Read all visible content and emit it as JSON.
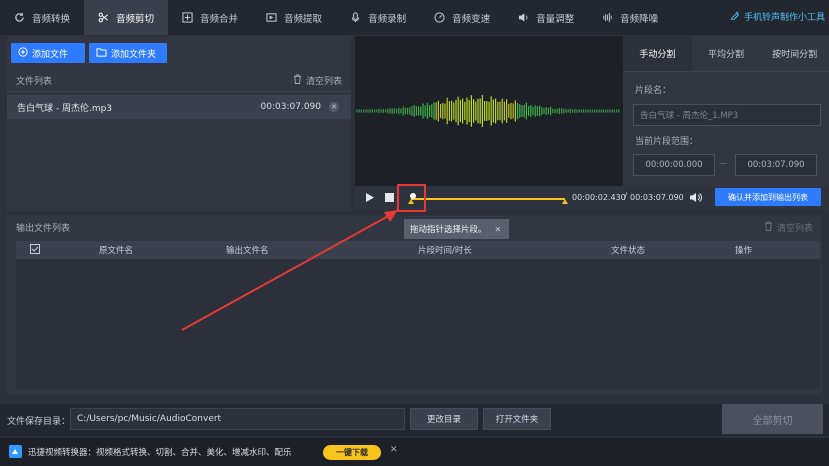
{
  "nav": {
    "tabs": [
      {
        "label": "音频转换",
        "icon": "refresh-icon"
      },
      {
        "label": "音频剪切",
        "icon": "scissors-icon"
      },
      {
        "label": "音频合并",
        "icon": "merge-icon"
      },
      {
        "label": "音频提取",
        "icon": "extract-icon"
      },
      {
        "label": "音频录制",
        "icon": "microphone-icon"
      },
      {
        "label": "音频变速",
        "icon": "speed-icon"
      },
      {
        "label": "音量调整",
        "icon": "volume-icon"
      },
      {
        "label": "音频降噪",
        "icon": "denoise-icon"
      }
    ],
    "active_tab": "音频剪切",
    "toolbox_label": "手机铃声制作小工具"
  },
  "left": {
    "add_file": "添加文件",
    "add_folder": "添加文件夹",
    "list_title": "文件列表",
    "clear_list": "清空列表",
    "file": {
      "name": "告白气球 - 周杰伦.mp3",
      "duration": "00:03:07.090"
    }
  },
  "player": {
    "current_time": "00:00:02.430",
    "separator": "/",
    "total_time": "00:03:07.090",
    "confirm_label": "确认并添加到输出列表"
  },
  "right": {
    "tabs": [
      "手动分割",
      "平均分割",
      "按时间分割"
    ],
    "segment_name_label": "片段名：",
    "segment_name_value": "告白气球 - 周杰伦_1.MP3",
    "range_label": "当前片段范围：",
    "range_start": "00:00:00.000",
    "range_dash": "—",
    "range_end": "00:03:07.090"
  },
  "tooltip": "拖动指针选择片段。",
  "output": {
    "title": "输出文件列表",
    "clear_list": "清空列表",
    "columns": [
      "原文件名",
      "输出文件名",
      "片段时间/时长",
      "文件状态",
      "操作"
    ]
  },
  "bottom": {
    "save_dir_label": "文件保存目录：",
    "save_path": "C:/Users/pc/Music/AudioConvert",
    "change_dir": "更改目录",
    "open_folder": "打开文件夹",
    "cut_all": "全部剪切"
  },
  "ad": {
    "text": "迅捷视频转换器：视频格式转换、切割、合并、美化、增减水印、配乐",
    "download": "一键下载"
  },
  "colors": {
    "accent": "#2f7bff",
    "highlight": "#f7c31d",
    "annotation": "#e53935",
    "wave_green": "#4caf50"
  }
}
